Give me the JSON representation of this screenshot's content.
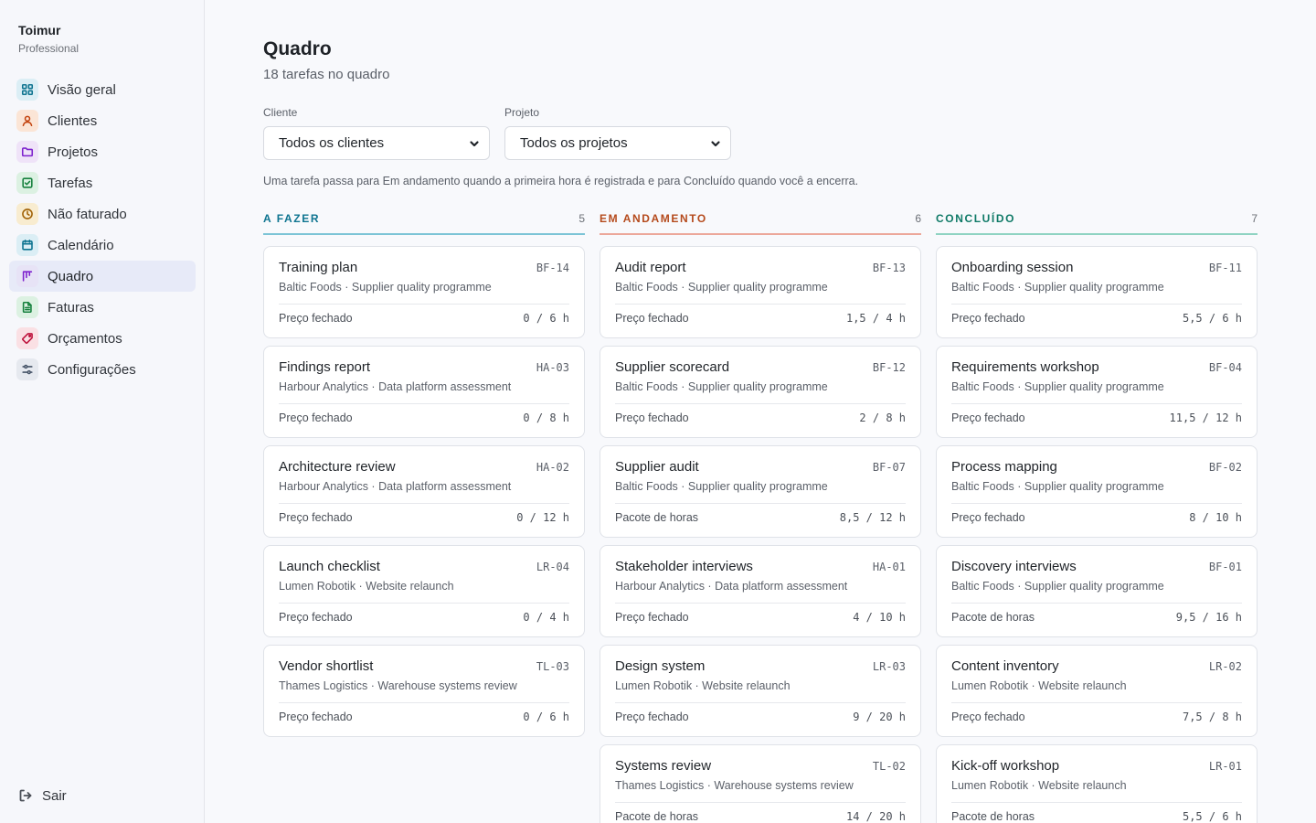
{
  "sidebar": {
    "brand_name": "Toimur",
    "brand_plan": "Professional",
    "items": [
      {
        "label": "Visão geral",
        "icon": "grid-icon",
        "color": "#0e7490",
        "bg": "#dbeef5"
      },
      {
        "label": "Clientes",
        "icon": "user-icon",
        "color": "#c2410c",
        "bg": "#fbe5d6"
      },
      {
        "label": "Projetos",
        "icon": "folder-icon",
        "color": "#7e22ce",
        "bg": "#efe3f8"
      },
      {
        "label": "Tarefas",
        "icon": "checkbox-icon",
        "color": "#15803d",
        "bg": "#dcf1e2"
      },
      {
        "label": "Não faturado",
        "icon": "clock-icon",
        "color": "#a16207",
        "bg": "#f8ecd0"
      },
      {
        "label": "Calendário",
        "icon": "calendar-icon",
        "color": "#0e7490",
        "bg": "#dbeef5"
      },
      {
        "label": "Quadro",
        "icon": "kanban-icon",
        "color": "#7e22ce",
        "bg": "#e7e3f6",
        "active": true
      },
      {
        "label": "Faturas",
        "icon": "document-icon",
        "color": "#15803d",
        "bg": "#dcf1e2"
      },
      {
        "label": "Orçamentos",
        "icon": "tag-icon",
        "color": "#be123c",
        "bg": "#fae0e4"
      },
      {
        "label": "Configurações",
        "icon": "sliders-icon",
        "color": "#475569",
        "bg": "#e6e9ef"
      }
    ],
    "logout_label": "Sair"
  },
  "header": {
    "title": "Quadro",
    "subtitle": "18 tarefas no quadro"
  },
  "filters": {
    "client_label": "Cliente",
    "client_value": "Todos os clientes",
    "project_label": "Projeto",
    "project_value": "Todos os projetos"
  },
  "hint": "Uma tarefa passa para Em andamento quando a primeira hora é registrada e para Concluído quando você a encerra.",
  "columns": [
    {
      "title": "A FAZER",
      "count": "5",
      "color": "#0e7490",
      "border": "#7cc4d6",
      "cards": [
        {
          "title": "Training plan",
          "code": "BF-14",
          "sub": "Baltic Foods · Supplier quality programme",
          "billing": "Preço fechado",
          "hours": "0 / 6 h"
        },
        {
          "title": "Findings report",
          "code": "HA-03",
          "sub": "Harbour Analytics · Data platform assessment",
          "billing": "Preço fechado",
          "hours": "0 / 8 h"
        },
        {
          "title": "Architecture review",
          "code": "HA-02",
          "sub": "Harbour Analytics · Data platform assessment",
          "billing": "Preço fechado",
          "hours": "0 / 12 h"
        },
        {
          "title": "Launch checklist",
          "code": "LR-04",
          "sub": "Lumen Robotik · Website relaunch",
          "billing": "Preço fechado",
          "hours": "0 / 4 h"
        },
        {
          "title": "Vendor shortlist",
          "code": "TL-03",
          "sub": "Thames Logistics · Warehouse systems review",
          "billing": "Preço fechado",
          "hours": "0 / 6 h"
        }
      ]
    },
    {
      "title": "EM ANDAMENTO",
      "count": "6",
      "color": "#b54a1c",
      "border": "#eca79a",
      "cards": [
        {
          "title": "Audit report",
          "code": "BF-13",
          "sub": "Baltic Foods · Supplier quality programme",
          "billing": "Preço fechado",
          "hours": "1,5 / 4 h"
        },
        {
          "title": "Supplier scorecard",
          "code": "BF-12",
          "sub": "Baltic Foods · Supplier quality programme",
          "billing": "Preço fechado",
          "hours": "2 / 8 h"
        },
        {
          "title": "Supplier audit",
          "code": "BF-07",
          "sub": "Baltic Foods · Supplier quality programme",
          "billing": "Pacote de horas",
          "hours": "8,5 / 12 h"
        },
        {
          "title": "Stakeholder interviews",
          "code": "HA-01",
          "sub": "Harbour Analytics · Data platform assessment",
          "billing": "Preço fechado",
          "hours": "4 / 10 h"
        },
        {
          "title": "Design system",
          "code": "LR-03",
          "sub": "Lumen Robotik · Website relaunch",
          "billing": "Preço fechado",
          "hours": "9 / 20 h"
        },
        {
          "title": "Systems review",
          "code": "TL-02",
          "sub": "Thames Logistics · Warehouse systems review",
          "billing": "Pacote de horas",
          "hours": "14 / 20 h"
        }
      ]
    },
    {
      "title": "CONCLUÍDO",
      "count": "7",
      "color": "#0f7a67",
      "border": "#8fd3c2",
      "cards": [
        {
          "title": "Onboarding session",
          "code": "BF-11",
          "sub": "Baltic Foods · Supplier quality programme",
          "billing": "Preço fechado",
          "hours": "5,5 / 6 h"
        },
        {
          "title": "Requirements workshop",
          "code": "BF-04",
          "sub": "Baltic Foods · Supplier quality programme",
          "billing": "Preço fechado",
          "hours": "11,5 / 12 h"
        },
        {
          "title": "Process mapping",
          "code": "BF-02",
          "sub": "Baltic Foods · Supplier quality programme",
          "billing": "Preço fechado",
          "hours": "8 / 10 h"
        },
        {
          "title": "Discovery interviews",
          "code": "BF-01",
          "sub": "Baltic Foods · Supplier quality programme",
          "billing": "Pacote de horas",
          "hours": "9,5 / 16 h"
        },
        {
          "title": "Content inventory",
          "code": "LR-02",
          "sub": "Lumen Robotik · Website relaunch",
          "billing": "Preço fechado",
          "hours": "7,5 / 8 h"
        },
        {
          "title": "Kick-off workshop",
          "code": "LR-01",
          "sub": "Lumen Robotik · Website relaunch",
          "billing": "Pacote de horas",
          "hours": "5,5 / 6 h"
        }
      ]
    }
  ]
}
